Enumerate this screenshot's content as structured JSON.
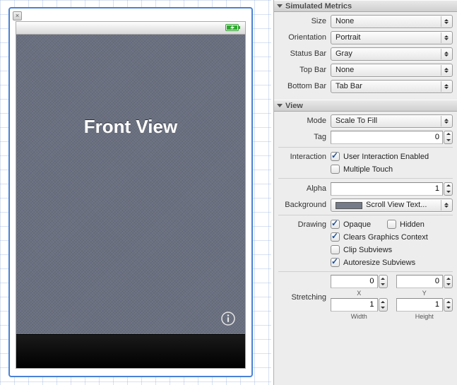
{
  "canvas": {
    "close_glyph": "×",
    "view_title": "Front View"
  },
  "sections": {
    "sim_metrics": "Simulated Metrics",
    "view": "View"
  },
  "sim": {
    "size_label": "Size",
    "size_value": "None",
    "orientation_label": "Orientation",
    "orientation_value": "Portrait",
    "statusbar_label": "Status Bar",
    "statusbar_value": "Gray",
    "topbar_label": "Top Bar",
    "topbar_value": "None",
    "bottombar_label": "Bottom Bar",
    "bottombar_value": "Tab Bar"
  },
  "view": {
    "mode_label": "Mode",
    "mode_value": "Scale To Fill",
    "tag_label": "Tag",
    "tag_value": "0",
    "interaction_label": "Interaction",
    "uie_label": "User Interaction Enabled",
    "uie_checked": true,
    "multitouch_label": "Multiple Touch",
    "multitouch_checked": false,
    "alpha_label": "Alpha",
    "alpha_value": "1",
    "bg_label": "Background",
    "bg_value": "Scroll View Text...",
    "drawing_label": "Drawing",
    "opaque_label": "Opaque",
    "opaque_checked": true,
    "hidden_label": "Hidden",
    "hidden_checked": false,
    "clears_label": "Clears Graphics Context",
    "clears_checked": true,
    "clip_label": "Clip Subviews",
    "clip_checked": false,
    "autoresize_label": "Autoresize Subviews",
    "autoresize_checked": true,
    "stretching_label": "Stretching",
    "x_value": "0",
    "x_label": "X",
    "y_value": "0",
    "y_label": "Y",
    "w_value": "1",
    "w_label": "Width",
    "h_value": "1",
    "h_label": "Height"
  }
}
